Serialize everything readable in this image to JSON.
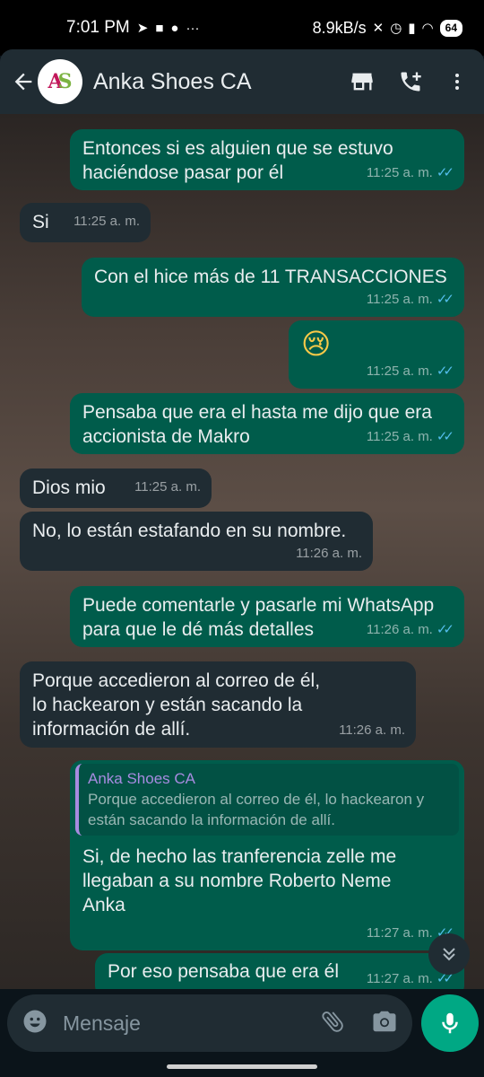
{
  "status_bar": {
    "time": "7:01 PM",
    "net_speed": "8.9kB/s",
    "battery": "64"
  },
  "header": {
    "back_icon": "arrow-left-icon",
    "contact_name": "Anka Shoes CA",
    "avatar_letters": [
      "A",
      "S"
    ],
    "icons": [
      "store-icon",
      "add-call-icon",
      "more-vert-icon"
    ]
  },
  "messages": [
    {
      "dir": "out",
      "text": "Entonces si es alguien que se estuvo haciéndose pasar por él",
      "time": "11:25 a. m."
    },
    {
      "dir": "in",
      "text": "Si",
      "time": "11:25 a. m."
    },
    {
      "dir": "out",
      "text": "Con el hice más de 11 TRANSACCIONES",
      "time": "11:25 a. m."
    },
    {
      "dir": "out",
      "text": "😢",
      "time": "11:25 a. m."
    },
    {
      "dir": "out",
      "text": "Pensaba que era el hasta me dijo que era accionista de Makro",
      "time": "11:25 a. m."
    },
    {
      "dir": "in",
      "text": "Dios mio",
      "time": "11:25 a. m."
    },
    {
      "dir": "in",
      "text": "No, lo están estafando en su nombre.",
      "time": "11:26 a. m."
    },
    {
      "dir": "out",
      "text": "Puede comentarle y pasarle mi WhatsApp para que le dé más detalles",
      "time": "11:26 a. m."
    },
    {
      "dir": "in",
      "text": "Porque accedieron al correo de él, lo hackearon y están sacando la información de allí.",
      "time": "11:26 a. m."
    },
    {
      "dir": "out",
      "quote_name": "Anka Shoes CA",
      "quote_text": "Porque accedieron al correo de él, lo hackearon y están sacando la información de allí.",
      "text": "Si, de hecho las tranferencia zelle me llegaban a su nombre Roberto Neme Anka",
      "time": "11:27 a. m."
    },
    {
      "dir": "out",
      "text": "Por eso pensaba que era él",
      "time": "11:27 a. m."
    }
  ],
  "input": {
    "placeholder": "Mensaje"
  },
  "colors": {
    "outgoing_bubble": "#005c4b",
    "incoming_bubble": "#202c33",
    "read_ticks": "#53bdeb",
    "accent": "#00a884"
  }
}
